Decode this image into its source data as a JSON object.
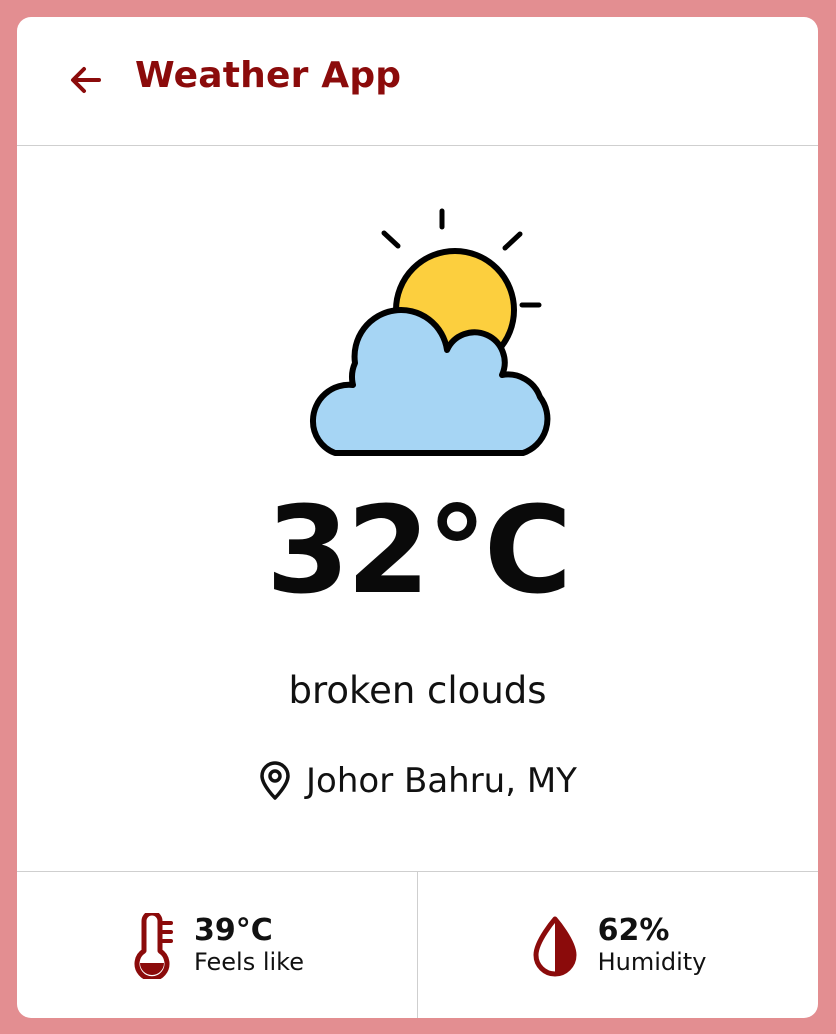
{
  "header": {
    "title": "Weather App",
    "back_icon": "arrow-left-icon"
  },
  "colors": {
    "page_background": "#e38e91",
    "accent": "#8b0b0b",
    "sun": "#fccf3e",
    "cloud": "#a6d5f4"
  },
  "current": {
    "icon": "sun-behind-cloud-icon",
    "temperature": "32°C",
    "description": "broken clouds",
    "location": "Johor Bahru, MY",
    "location_icon": "map-pin-icon"
  },
  "stats": [
    {
      "icon": "thermometer-icon",
      "value": "39°C",
      "label": "Feels like"
    },
    {
      "icon": "water-drop-icon",
      "value": "62%",
      "label": "Humidity"
    }
  ]
}
